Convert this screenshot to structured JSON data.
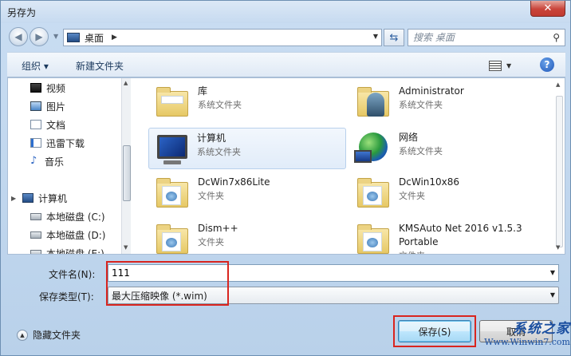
{
  "window": {
    "title": "另存为"
  },
  "address": {
    "crumb": "桌面"
  },
  "search": {
    "placeholder": "搜索 桌面"
  },
  "toolbar": {
    "organize": "组织 ▾",
    "new_folder": "新建文件夹"
  },
  "sidebar": {
    "items": [
      {
        "label": "视频",
        "icon": "video-icon"
      },
      {
        "label": "图片",
        "icon": "pictures-icon"
      },
      {
        "label": "文档",
        "icon": "documents-icon"
      },
      {
        "label": "迅雷下载",
        "icon": "downloads-icon"
      },
      {
        "label": "音乐",
        "icon": "music-icon"
      }
    ],
    "computer": {
      "label": "计算机"
    },
    "drives": [
      {
        "label": "本地磁盘 (C:)"
      },
      {
        "label": "本地磁盘 (D:)"
      },
      {
        "label": "本地磁盘 (E:)"
      }
    ]
  },
  "files": [
    {
      "name": "库",
      "type": "系统文件夹",
      "icon": "library-icon"
    },
    {
      "name": "Administrator",
      "type": "系统文件夹",
      "icon": "user-folder-icon"
    },
    {
      "name": "计算机",
      "type": "系统文件夹",
      "icon": "computer-icon"
    },
    {
      "name": "网络",
      "type": "系统文件夹",
      "icon": "network-icon"
    },
    {
      "name": "DcWin7x86Lite",
      "type": "文件夹",
      "icon": "folder-icon"
    },
    {
      "name": "DcWin10x86",
      "type": "文件夹",
      "icon": "folder-icon"
    },
    {
      "name": "Dism++",
      "type": "文件夹",
      "icon": "folder-icon"
    },
    {
      "name": "KMSAuto Net 2016 v1.5.3 Portable",
      "type": "文件夹",
      "icon": "folder-icon"
    }
  ],
  "form": {
    "filename_label": "文件名(N):",
    "filename_value": "111",
    "filetype_label": "保存类型(T):",
    "filetype_value": "最大压缩映像 (*.wim)"
  },
  "footer": {
    "hide_folders": "隐藏文件夹",
    "save": "保存(S)",
    "cancel": "取消"
  },
  "watermark": {
    "brand": "系统之家",
    "url": "Www.Winwin7.com"
  },
  "colors": {
    "highlight": "#d9251f",
    "accent": "#3c7fb1"
  }
}
